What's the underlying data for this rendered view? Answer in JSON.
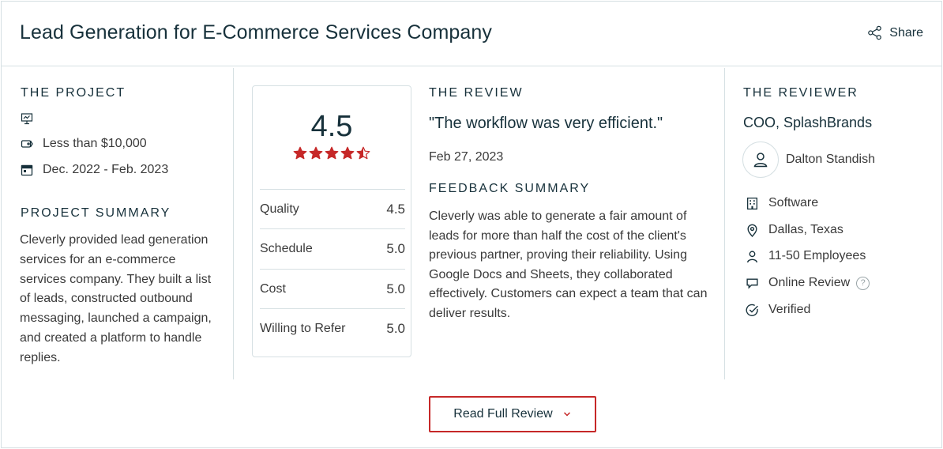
{
  "header": {
    "title": "Lead Generation for E-Commerce Services Company",
    "share_label": "Share"
  },
  "project": {
    "heading": "THE PROJECT",
    "budget": "Less than $10,000",
    "dates": "Dec. 2022 - Feb. 2023",
    "summary_heading": "PROJECT SUMMARY",
    "summary": "Cleverly provided lead generation services for an e-commerce services company. They built a list of leads, constructed outbound messaging, launched a campaign, and created a platform to handle replies."
  },
  "scores": {
    "overall": "4.5",
    "overall_rating": 4.5,
    "max_rating": 5,
    "items": [
      {
        "label": "Quality",
        "value": "4.5"
      },
      {
        "label": "Schedule",
        "value": "5.0"
      },
      {
        "label": "Cost",
        "value": "5.0"
      },
      {
        "label": "Willing to Refer",
        "value": "5.0"
      }
    ],
    "star_color": "#c62828"
  },
  "review": {
    "heading": "THE REVIEW",
    "quote": "\"The workflow was very efficient.\"",
    "date": "Feb 27, 2023",
    "feedback_heading": "FEEDBACK SUMMARY",
    "feedback": "Cleverly was able to generate a fair amount of leads for more than half the cost of the client's previous partner, proving their reliability. Using Google Docs and Sheets, they collaborated effectively. Customers can expect a team that can deliver results."
  },
  "reviewer": {
    "heading": "THE REVIEWER",
    "role": "COO, SplashBrands",
    "name": "Dalton Standish",
    "industry": "Software",
    "location": "Dallas, Texas",
    "employees": "11-50 Employees",
    "review_type": "Online Review",
    "help_mark": "?",
    "verified": "Verified"
  },
  "footer": {
    "read_full_label": "Read Full Review"
  },
  "colors": {
    "accent": "#c62828",
    "text_dark": "#17313b",
    "border": "#d6e0e3"
  },
  "icons": {
    "share": "share-icon",
    "presentation": "presentation-icon",
    "price_tag": "price-tag-icon",
    "calendar": "calendar-icon",
    "user": "user-icon",
    "building": "building-icon",
    "location": "location-pin-icon",
    "people": "people-icon",
    "chat": "chat-icon",
    "verified": "check-circle-icon",
    "chevron": "chevron-down-icon"
  }
}
